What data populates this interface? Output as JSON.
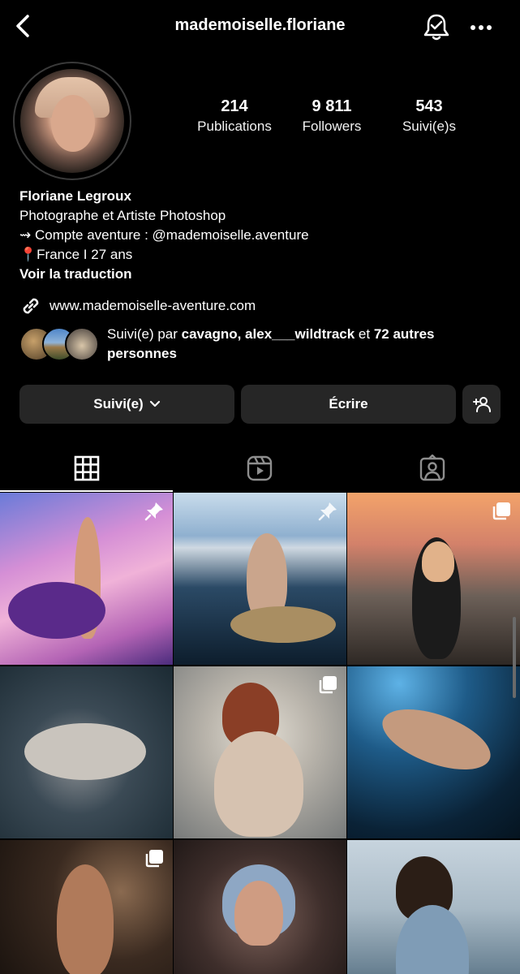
{
  "header": {
    "username": "mademoiselle.floriane"
  },
  "icons": {
    "back": "chevron-left-icon",
    "notifications": "bell-check-icon",
    "more": "more-horizontal-icon",
    "link": "link-icon",
    "add_user": "add-user-icon",
    "grid": "grid-icon",
    "reels": "reels-icon",
    "tagged": "tagged-icon",
    "pin": "pin-icon",
    "carousel": "carousel-icon"
  },
  "stats": [
    {
      "value": "214",
      "label": "Publications"
    },
    {
      "value": "9 811",
      "label": "Followers"
    },
    {
      "value": "543",
      "label": "Suivi(e)s"
    }
  ],
  "bio": {
    "name": "Floriane Legroux",
    "line1": "Photographe et Artiste Photoshop",
    "line2": "⇝ Compte aventure : @mademoiselle.aventure",
    "line3": "📍France I 27 ans",
    "translate": "Voir la traduction",
    "link": "www.mademoiselle-aventure.com"
  },
  "mutual": {
    "prefix": "Suivi(e) par ",
    "users": "cavagno, alex___wildtrack",
    "middle": " et ",
    "others": "72 autres personnes"
  },
  "buttons": {
    "follow": "Suivi(e)",
    "message": "Écrire"
  },
  "grid": [
    {
      "badge": "pin"
    },
    {
      "badge": "pin"
    },
    {
      "badge": "carousel"
    },
    {
      "badge": ""
    },
    {
      "badge": "carousel"
    },
    {
      "badge": ""
    },
    {
      "badge": "carousel"
    },
    {
      "badge": ""
    },
    {
      "badge": ""
    }
  ],
  "colors": {
    "background": "#000000",
    "button": "#262626",
    "text": "#ffffff"
  }
}
